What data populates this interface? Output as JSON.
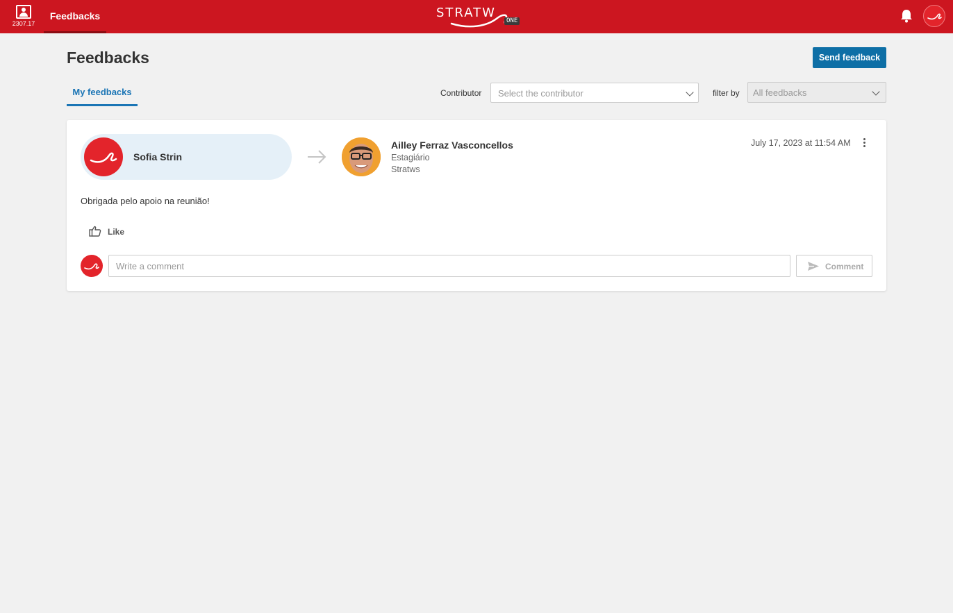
{
  "topbar": {
    "version": "2307.17",
    "nav_tab": "Feedbacks",
    "logo_text": "STRATW",
    "logo_badge": "ONE",
    "bell_icon": "bell-icon",
    "brand_color": "#cc1620"
  },
  "page": {
    "title": "Feedbacks",
    "send_button": "Send feedback",
    "tab_label": "My feedbacks"
  },
  "filters": {
    "contributor_label": "Contributor",
    "contributor_placeholder": "Select the contributor",
    "filter_label": "filter by",
    "filter_value": "All feedbacks"
  },
  "feedback": {
    "sender_name": "Sofia Strin",
    "receiver_name": "Ailley Ferraz Vasconcellos",
    "receiver_role": "Estagiário",
    "receiver_company": "Stratws",
    "date": "July 17, 2023 at 11:54 AM",
    "message": "Obrigada pelo apoio na reunião!",
    "like_label": "Like",
    "comment_placeholder": "Write a comment",
    "comment_button": "Comment"
  }
}
